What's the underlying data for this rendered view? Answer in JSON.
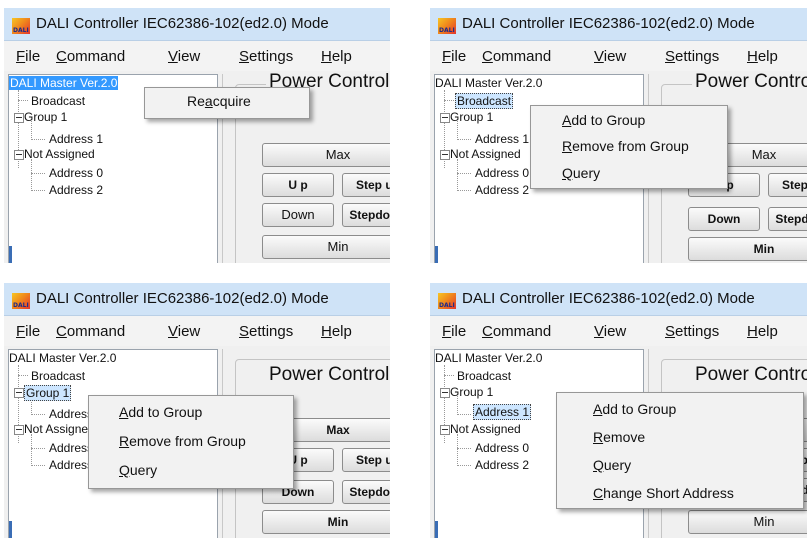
{
  "app": {
    "title": "DALI Controller IEC62386-102(ed2.0) Mode",
    "icon_label": "DALI"
  },
  "menu": [
    {
      "pre": "",
      "u": "F",
      "post": "ile"
    },
    {
      "pre": "",
      "u": "C",
      "post": "ommand"
    },
    {
      "pre": "",
      "u": "V",
      "post": "iew"
    },
    {
      "pre": "",
      "u": "S",
      "post": "ettings"
    },
    {
      "pre": "",
      "u": "H",
      "post": "elp"
    }
  ],
  "tree": {
    "root": "DALI Master Ver.2.0",
    "broadcast": "Broadcast",
    "group1": "Group 1",
    "address1": "Address 1",
    "not_assigned": "Not Assigned",
    "address0": "Address 0",
    "address2": "Address 2"
  },
  "power": {
    "title": "Power Control",
    "max": "Max",
    "up": "U p",
    "step_up": "Step up",
    "down": "Down",
    "step_down": "Stepdown",
    "min": "Min"
  },
  "context_menus": {
    "panel1": [
      {
        "pre": "Re",
        "u": "a",
        "post": "cquire"
      }
    ],
    "panel2": [
      {
        "pre": "",
        "u": "A",
        "post": "dd to Group"
      },
      {
        "pre": "",
        "u": "R",
        "post": "emove from Group"
      },
      {
        "pre": "",
        "u": "Q",
        "post": "uery"
      }
    ],
    "panel3": [
      {
        "pre": "",
        "u": "A",
        "post": "dd to Group"
      },
      {
        "pre": "",
        "u": "R",
        "post": "emove from Group"
      },
      {
        "pre": "",
        "u": "Q",
        "post": "uery"
      }
    ],
    "panel4": [
      {
        "pre": "",
        "u": "A",
        "post": "dd to Group"
      },
      {
        "pre": "",
        "u": "R",
        "post": "emove"
      },
      {
        "pre": "",
        "u": "Q",
        "post": "uery"
      },
      {
        "pre": "",
        "u": "C",
        "post": "hange Short Address"
      }
    ]
  },
  "colors": {
    "selection": "#3399ff",
    "titlebar": "#cfe3f7"
  }
}
